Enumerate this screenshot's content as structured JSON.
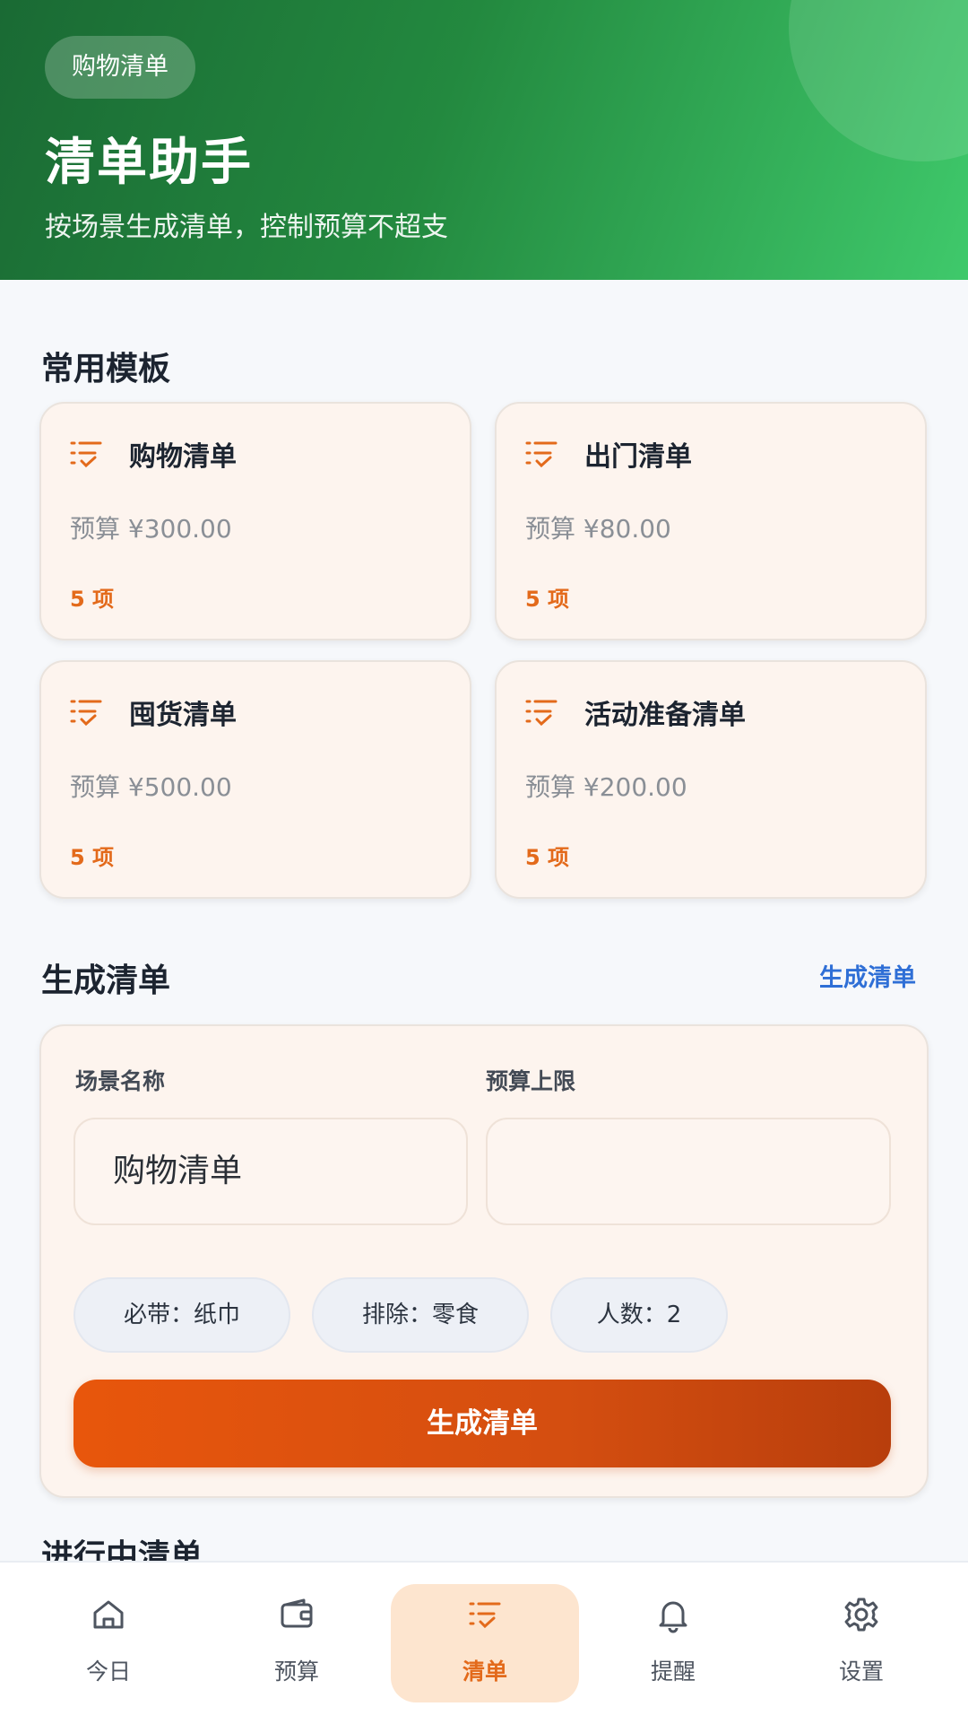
{
  "header": {
    "pill": "购物清单",
    "title": "清单助手",
    "subtitle": "按场景生成清单，控制预算不超支"
  },
  "templates": {
    "title": "常用模板",
    "items": [
      {
        "name": "购物清单",
        "budget": "预算 ¥300.00",
        "count": "5 项",
        "icon": "checklist-icon"
      },
      {
        "name": "出门清单",
        "budget": "预算 ¥80.00",
        "count": "5 项",
        "icon": "checklist-icon"
      },
      {
        "name": "囤货清单",
        "budget": "预算 ¥500.00",
        "count": "5 项",
        "icon": "checklist-icon"
      },
      {
        "name": "活动准备清单",
        "budget": "预算 ¥200.00",
        "count": "5 项",
        "icon": "checklist-icon"
      }
    ]
  },
  "generate": {
    "title": "生成清单",
    "link": "生成清单",
    "scene_label": "场景名称",
    "scene_value": "购物清单",
    "budget_label": "预算上限",
    "budget_value": "",
    "chips": [
      "必带：纸巾",
      "排除：零食",
      "人数：2"
    ],
    "button": "生成清单"
  },
  "in_progress": {
    "title": "进行中清单"
  },
  "colors": {
    "accent": "#e36a1b",
    "header_green": "#23893f",
    "link_blue": "#2f6fd6"
  },
  "nav": {
    "items": [
      {
        "label": "今日",
        "icon": "home-icon"
      },
      {
        "label": "预算",
        "icon": "wallet-icon"
      },
      {
        "label": "清单",
        "icon": "checklist-icon",
        "active": true
      },
      {
        "label": "提醒",
        "icon": "bell-icon"
      },
      {
        "label": "设置",
        "icon": "gear-icon"
      }
    ]
  }
}
